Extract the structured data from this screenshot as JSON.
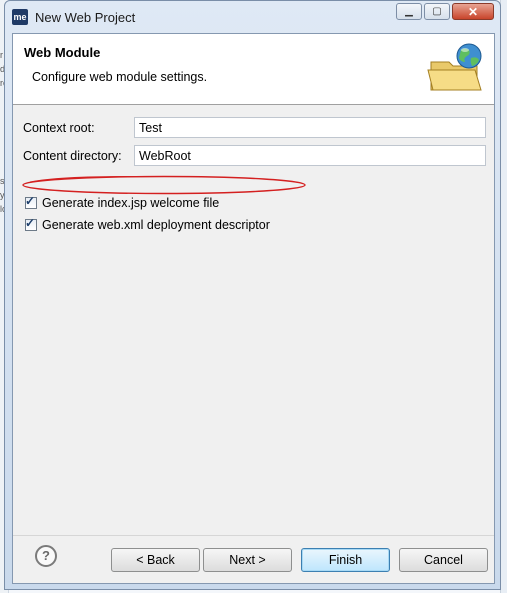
{
  "window": {
    "title": "New Web Project",
    "app_icon_text": "me"
  },
  "banner": {
    "title": "Web Module",
    "description": "Configure web module settings.",
    "icon": "web-folder-globe-icon"
  },
  "form": {
    "context_root_label": "Context root:",
    "context_root_value": "Test",
    "content_directory_label": "Content directory:",
    "content_directory_value": "WebRoot",
    "checkboxes": [
      {
        "label": "Generate index.jsp welcome file",
        "checked": true
      },
      {
        "label": "Generate web.xml deployment descriptor",
        "checked": true
      }
    ]
  },
  "buttons": {
    "back": "< Back",
    "next": "Next >",
    "finish": "Finish",
    "cancel": "Cancel",
    "help_icon": "?"
  },
  "background_letters": "r\nd\nro\n\n\n\n\n\n\ns\ny\nlc",
  "colors": {
    "annotation": "#d42020",
    "default_button_border": "#3c7fb1"
  }
}
